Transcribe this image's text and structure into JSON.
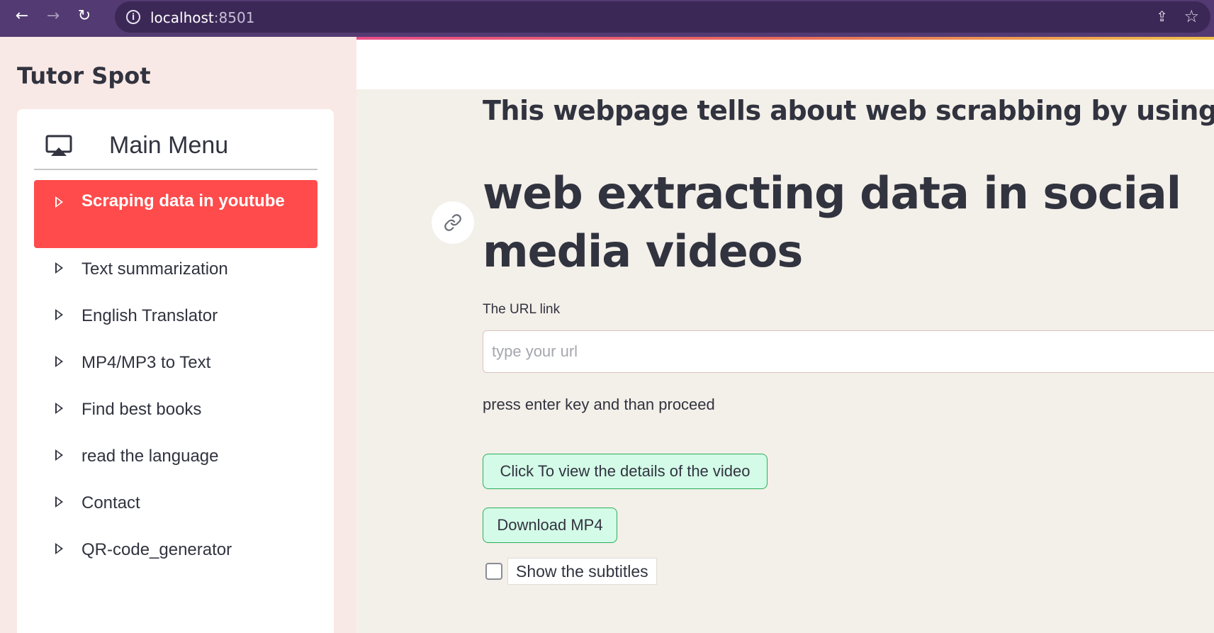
{
  "browser": {
    "url_host": "localhost",
    "url_port": ":8501"
  },
  "sidebar": {
    "app_title": "Tutor Spot",
    "menu_title": "Main Menu",
    "items": [
      {
        "label": "Scraping data in youtube",
        "active": true
      },
      {
        "label": "Text summarization",
        "active": false
      },
      {
        "label": "English Translator",
        "active": false
      },
      {
        "label": "MP4/MP3 to Text",
        "active": false
      },
      {
        "label": "Find best books",
        "active": false
      },
      {
        "label": "read the language",
        "active": false
      },
      {
        "label": "Contact",
        "active": false
      },
      {
        "label": "QR-code_generator",
        "active": false
      }
    ]
  },
  "main": {
    "subtitle": "This webpage tells about web scrabbing by using AI",
    "heading": "web extracting data in social media videos",
    "url_field": {
      "label": "The URL link",
      "placeholder": "type your url",
      "value": ""
    },
    "hint": "press enter key and than proceed",
    "details_button": "Click To view the details of the video",
    "download_button": "Download MP4",
    "subtitles_checkbox": {
      "label": "Show the subtitles",
      "checked": false
    }
  },
  "colors": {
    "accent": "#ff4b4b",
    "button_bg": "#d4fbe8",
    "button_border": "#2bb05a",
    "chrome": "#533a72"
  }
}
